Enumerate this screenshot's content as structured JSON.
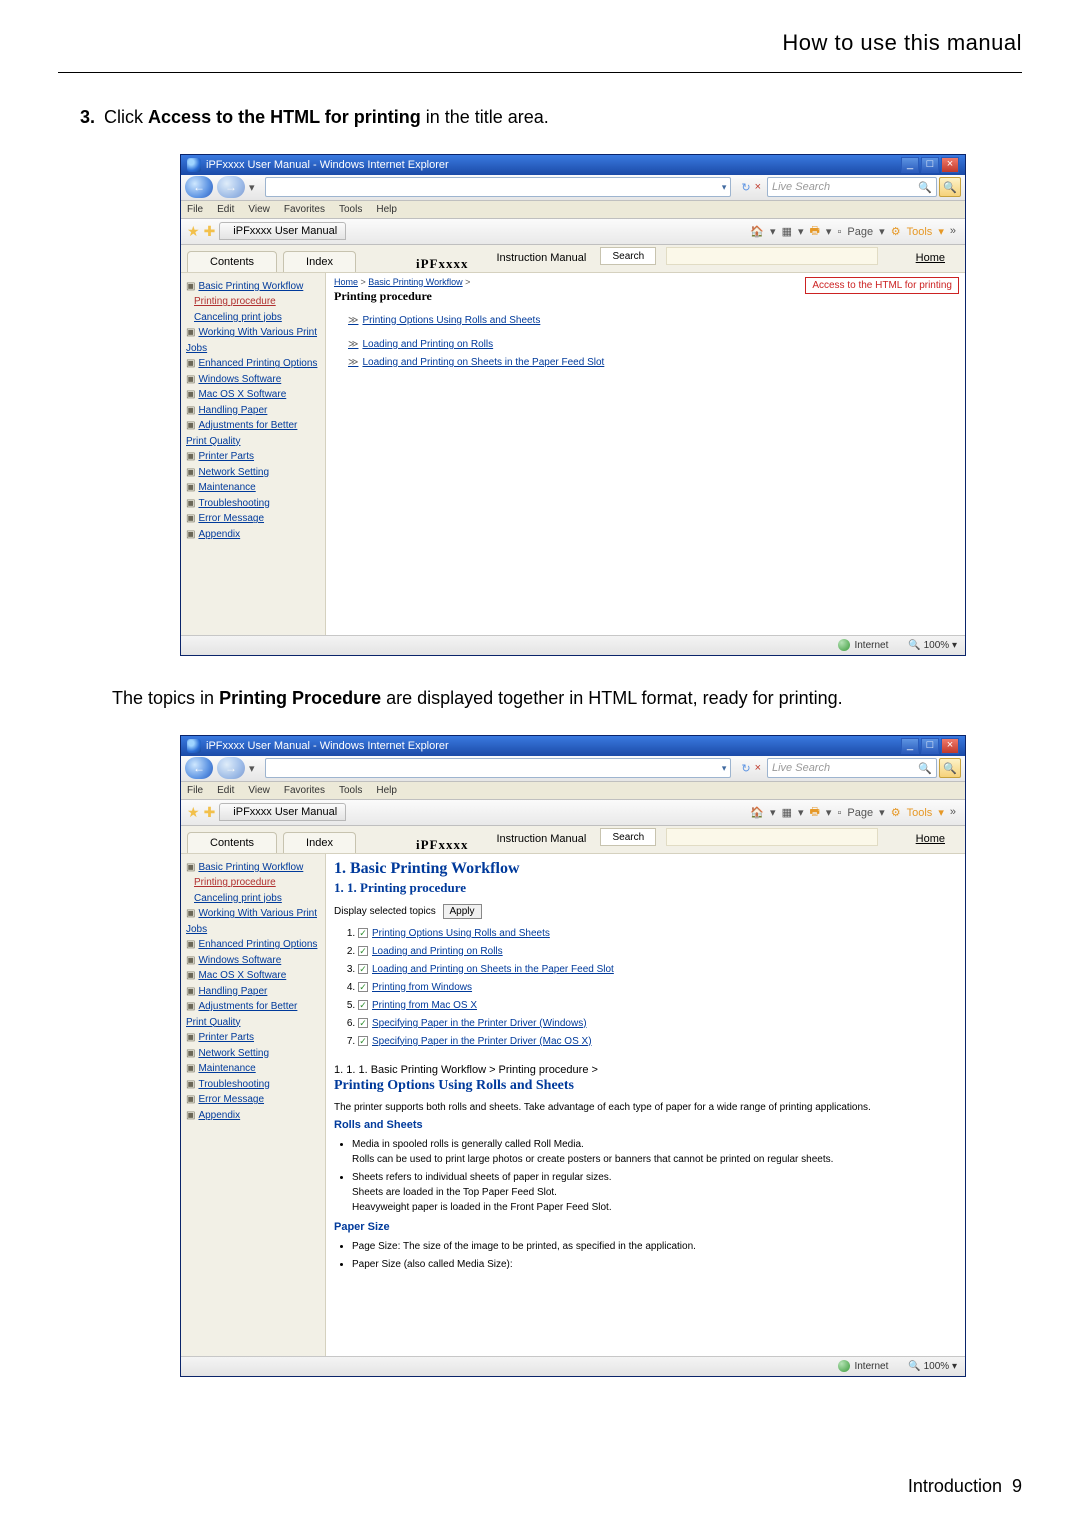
{
  "header": {
    "section_title": "How to use this manual"
  },
  "step": {
    "number": "3.",
    "prefix": "Click ",
    "bold": "Access to the HTML for printing",
    "suffix": " in the title area."
  },
  "followup": {
    "prefix": "The topics in ",
    "bold": "Printing Procedure",
    "suffix": " are displayed together in HTML format, ready for printing."
  },
  "footer": {
    "chapter": "Introduction",
    "page": "9"
  },
  "ie": {
    "title": "iPFxxxx User Manual - Windows Internet Explorer",
    "live_search": "Live Search",
    "menus": [
      "File",
      "Edit",
      "View",
      "Favorites",
      "Tools",
      "Help"
    ],
    "tab": "iPFxxxx User Manual",
    "toolbar": {
      "page": "Page",
      "tools": "Tools"
    },
    "status": {
      "zone": "Internet",
      "zoom": "100%"
    }
  },
  "manual": {
    "tabs": {
      "contents": "Contents",
      "index": "Index"
    },
    "brand": "iPFxxxx",
    "instruction": "Instruction Manual",
    "search": "Search",
    "home": "Home"
  },
  "toc": {
    "items": [
      "Basic Printing Workflow",
      "Working With Various Print Jobs",
      "Enhanced Printing Options",
      "Windows Software",
      "Mac OS X Software",
      "Handling Paper",
      "Adjustments for Better Print Quality",
      "Printer Parts",
      "Network Setting",
      "Maintenance",
      "Troubleshooting",
      "Error Message",
      "Appendix"
    ],
    "sub1": "Printing procedure",
    "sub2": "Canceling print jobs"
  },
  "shot1": {
    "breadcrumb_home": "Home",
    "breadcrumb_parent": "Basic Printing Workflow",
    "title": "Printing procedure",
    "access_btn": "Access to the HTML for printing",
    "links": [
      "Printing Options Using Rolls and Sheets",
      "Loading and Printing on Rolls",
      "Loading and Printing on Sheets in the Paper Feed Slot"
    ]
  },
  "shot2": {
    "h1": "1. Basic Printing Workflow",
    "h2": "1. 1. Printing procedure",
    "display_label": "Display selected topics",
    "apply": "Apply",
    "checklist": [
      "Printing Options Using Rolls and Sheets",
      "Loading and Printing on Rolls",
      "Loading and Printing on Sheets in the Paper Feed Slot",
      "Printing from Windows",
      "Printing from Mac OS X",
      "Specifying Paper in the Printer Driver (Windows)",
      "Specifying Paper in the Printer Driver (Mac OS X)"
    ],
    "sec_crumb": "1. 1. 1.  Basic Printing Workflow > Printing procedure >",
    "h3": "Printing Options Using Rolls and Sheets",
    "p1": "The printer supports both rolls and sheets. Take advantage of each type of paper for a wide range of printing applications.",
    "rolls_heading": "Rolls and Sheets",
    "rolls_b1": "Media in spooled rolls is generally called Roll Media.",
    "rolls_b1b": "Rolls can be used to print large photos or create posters or banners that cannot be printed on regular sheets.",
    "rolls_b2": "Sheets refers to individual sheets of paper in regular sizes.",
    "rolls_b2b": "Sheets are loaded in the Top Paper Feed Slot.",
    "rolls_b2c": "Heavyweight paper is loaded in the Front Paper Feed Slot.",
    "paper_heading": "Paper Size",
    "paper_b1": "Page Size: The size of the image to be printed, as specified in the application.",
    "paper_b2": "Paper Size (also called Media Size):"
  }
}
